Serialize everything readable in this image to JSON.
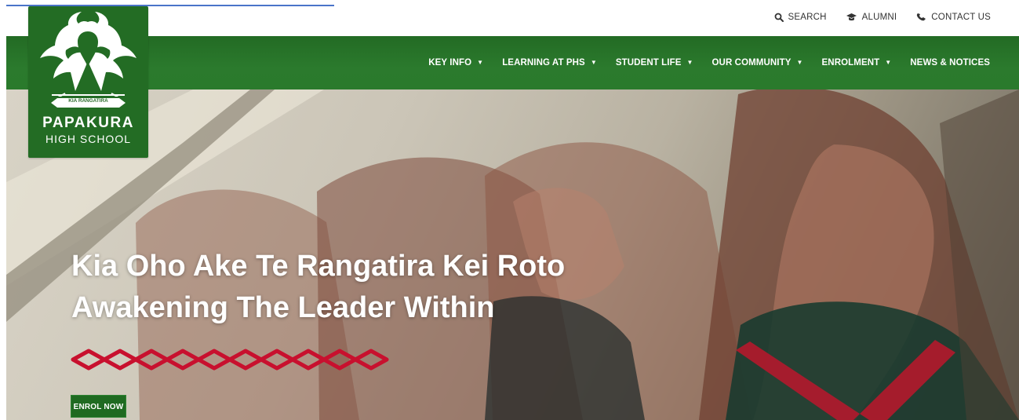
{
  "page": {
    "utility_links": [
      {
        "label": "SEARCH",
        "icon": "search-icon"
      },
      {
        "label": "ALUMNI",
        "icon": "alumni-icon"
      },
      {
        "label": "CONTACT US",
        "icon": "phone-icon"
      }
    ]
  },
  "logo": {
    "ribbon_text": "KIA RANGATIRA",
    "title": "PAPAKURA",
    "subtitle": "HIGH SCHOOL"
  },
  "navigation": [
    {
      "label": "KEY INFO",
      "has_dropdown": true
    },
    {
      "label": "LEARNING AT PHS",
      "has_dropdown": true
    },
    {
      "label": "STUDENT LIFE",
      "has_dropdown": true
    },
    {
      "label": "OUR COMMUNITY",
      "has_dropdown": true
    },
    {
      "label": "ENROLMENT",
      "has_dropdown": true
    },
    {
      "label": "NEWS & NOTICES",
      "has_dropdown": false
    }
  ],
  "hero": {
    "headline_line_1": "Kia Oho Ake Te Rangatira Kei Roto",
    "headline_line_2": "Awakening The Leader Within",
    "button_label": "ENROL NOW"
  },
  "colors": {
    "brand_green": "#236c24",
    "accent_red": "#c8102e"
  }
}
